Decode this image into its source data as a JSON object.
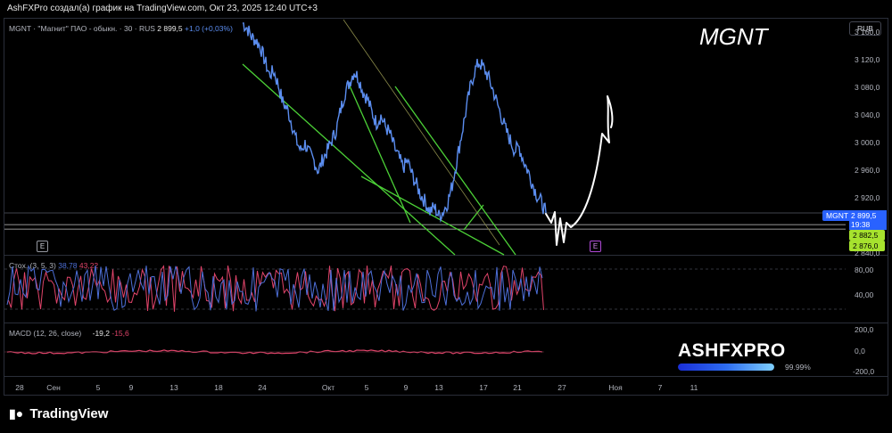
{
  "header_text": "AshFXPro создал(а) график на TradingView.com, Окт 23, 2025 12:40 UTC+3",
  "legend": {
    "symbol": "MGNT · \"Магнит\" ПАО - обыкн. · 30 · RUS",
    "price": "2 899,5",
    "change": "+1,0 (+0,03%)"
  },
  "currency": "RUB",
  "watermark": "MGNT",
  "price_axis_ticks": [
    "3 160,0",
    "3 120,0",
    "3 080,0",
    "3 040,0",
    "3 000,0",
    "2 960,0",
    "2 920,0",
    "2 840,0"
  ],
  "price_badges": {
    "symbol": "MGNT",
    "last": "2 899,5",
    "countdown": "19:38",
    "level1": "2 882,5",
    "level2": "2 876,0"
  },
  "earnings_marker": "E",
  "stoch": {
    "label": "Стох. (3, 5, 3)",
    "k": "38,78",
    "d": "43,22",
    "ticks": [
      "80,00",
      "40,00"
    ]
  },
  "macd": {
    "label": "MACD (12, 26, close)",
    "v1": "-19,2",
    "v2": "-15,6",
    "ticks": [
      "200,0",
      "0,0",
      "-200,0"
    ]
  },
  "brand": {
    "name": "ASHFXPRO",
    "progress_text": "99.99%",
    "progress": 0.9999
  },
  "date_labels": [
    "28",
    "Сен",
    "5",
    "9",
    "13",
    "18",
    "24",
    "Окт",
    "5",
    "9",
    "13",
    "17",
    "21",
    "27",
    "Ноя",
    "7",
    "11"
  ],
  "footer_logo": "TradingView",
  "colors": {
    "price_line": "#5b8def",
    "trendline": "#4cd137",
    "stoch_k": "#4d6fd8",
    "stoch_d": "#e0446a",
    "macd": "#e0446a",
    "drawing": "#ffffff",
    "badge_green": "#a6e22e"
  },
  "chart_data": {
    "type": "line",
    "ylim": [
      2840,
      3180
    ],
    "series": [
      {
        "values": [
          3175,
          3168,
          3155,
          3150,
          3140,
          3120,
          3100,
          3105,
          3085,
          3060,
          3050,
          3030,
          3005,
          2990,
          3000,
          2985,
          2975,
          2960,
          2978,
          2990,
          3005,
          3020,
          3050,
          3075,
          3090,
          3105,
          3095,
          3075,
          3065,
          3045,
          3030,
          3040,
          3025,
          3015,
          2995,
          2980,
          2965,
          2975,
          2955,
          2940,
          2925,
          2915,
          2902,
          2908,
          2895,
          2902,
          2915,
          2940,
          2975,
          3010,
          3045,
          3080,
          3105,
          3118,
          3110,
          3098,
          3080,
          3060,
          3040,
          3020,
          3005,
          2990,
          2995,
          2975,
          2960,
          2942,
          2925,
          2915,
          2899.5
        ]
      }
    ]
  }
}
